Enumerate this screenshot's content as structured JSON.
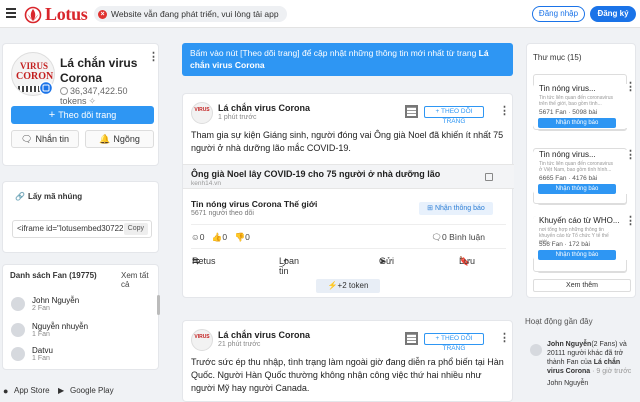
{
  "header": {
    "logo_text": "Lotus",
    "notice": "Website vẫn đang phát triển, vui lòng tải app",
    "login": "Đăng nhập",
    "signup": "Đăng ký"
  },
  "profile": {
    "avatar_line1": "VIRUS",
    "avatar_line2": "CORONA",
    "name": "Lá chắn virus Corona",
    "tokens": "36,347,422.50 tokens",
    "follow": "Theo dõi trang",
    "message": "Nhắn tin",
    "block": "Ngõng"
  },
  "embed": {
    "title": "Lấy mã nhúng",
    "code": "<iframe id=\"lotusembed30722",
    "copy": "Copy"
  },
  "fans": {
    "title": "Danh sách Fan (19775)",
    "see_all": "Xem tất cả",
    "items": [
      {
        "name": "John Nguyễn",
        "count": "2 Fan"
      },
      {
        "name": "Nguyễn nhuyễn",
        "count": "1 Fan"
      },
      {
        "name": "Datvu",
        "count": "1 Fan"
      }
    ]
  },
  "stores": {
    "appstore": "App Store",
    "googleplay": "Google Play"
  },
  "banner": {
    "text": "Bấm vào nút [Theo dõi trang] để cập nhật những thông tin mới nhất từ trang ",
    "page": "Lá chắn virus Corona"
  },
  "post1": {
    "author": "Lá chắn virus Corona",
    "time": "1 phút trước",
    "follow": "THEO DÕI TRANG",
    "text": "Tham gia sự kiện Giáng sinh, người đóng vai Ông già Noel đã khiến ít nhất 75 người ở nhà dưỡng lão mắc COVID-19.",
    "link_title": "Ông già Noel lây COVID-19 cho 75 người ở nhà dưỡng lão",
    "link_source": "kenh14.vn",
    "sub_name": "Tin nóng virus Corona Thế giới",
    "sub_count": "5671 người theo dõi",
    "notify": "Nhận thông báo",
    "react1": "0",
    "react2": "0",
    "react3": "0",
    "comments": "0 Bình luận",
    "retweet": "Retus",
    "share": "Loan tin",
    "send": "Gửi",
    "save": "Lưu",
    "token": "+2 token"
  },
  "post2": {
    "author": "Lá chắn virus Corona",
    "time": "21 phút trước",
    "follow": "THEO DÕI TRANG",
    "text": "Trước sức ép thu nhập, tình trạng làm ngoài giờ đang diễn ra phổ biến tại Hàn Quốc. Người Hàn Quốc thường không nhận công việc thứ hai nhiều như người Mỹ hay người Canada."
  },
  "directory": {
    "title": "Thư mục (15)",
    "items": [
      {
        "name": "Tin nóng virus...",
        "desc": "Tin tức liên quan đến coronavirus trên thế giới, bao gồm tình...",
        "stats": "5671 Fan · 5098 bài",
        "btn": "Nhận thông báo"
      },
      {
        "name": "Tin nóng virus...",
        "desc": "Tin tức liên quan đến coronavirus ở Việt Nam, bao gồm tình hình...",
        "stats": "6665 Fan · 4176 bài",
        "btn": "Nhận thông báo"
      },
      {
        "name": "Khuyến cáo từ WHO...",
        "desc": "nơi tổng hợp những thông tin khuyến cáo từ Tổ chức Y tế thế giới...",
        "stats": "556 Fan · 172 bài",
        "btn": "Nhận thông báo"
      }
    ],
    "more": "Xem thêm"
  },
  "recent": {
    "title": "Hoạt động gần đây",
    "text_a": "John Nguyễn",
    "text_b": "(2 Fans) và 20111 người khác đã trở thành Fan của ",
    "page": "Lá chắn virus Corona",
    "time": " · 9 giờ trước",
    "next": "John Nguyễn"
  }
}
